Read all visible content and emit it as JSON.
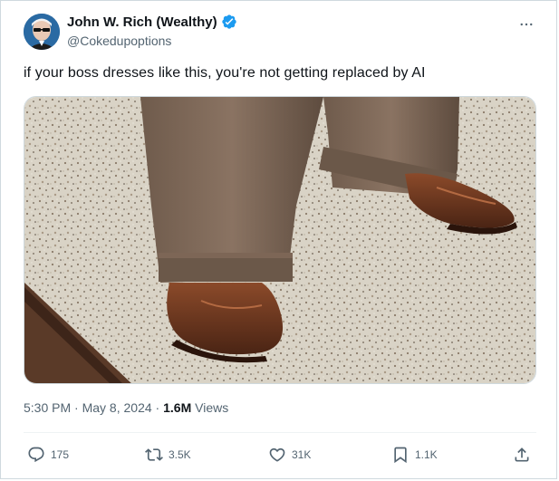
{
  "author": {
    "name": "John W. Rich (Wealthy)",
    "handle": "@Cokedupoptions"
  },
  "tweet": {
    "text": "if your boss dresses like this, you're not getting replaced by AI"
  },
  "meta": {
    "time": "5:30 PM",
    "date": "May 8, 2024",
    "separator": " · ",
    "views_count": "1.6M",
    "views_label": "Views"
  },
  "actions": {
    "replies": "175",
    "reposts": "3.5K",
    "likes": "31K",
    "bookmarks": "1.1K"
  },
  "colors": {
    "verified": "#1d9bf0",
    "secondary_text": "#536471",
    "primary_text": "#0f1419"
  },
  "icons": {
    "more": "more-options-icon",
    "reply": "reply-icon",
    "repost": "repost-icon",
    "like": "heart-icon",
    "bookmark": "bookmark-icon",
    "share": "share-icon"
  }
}
